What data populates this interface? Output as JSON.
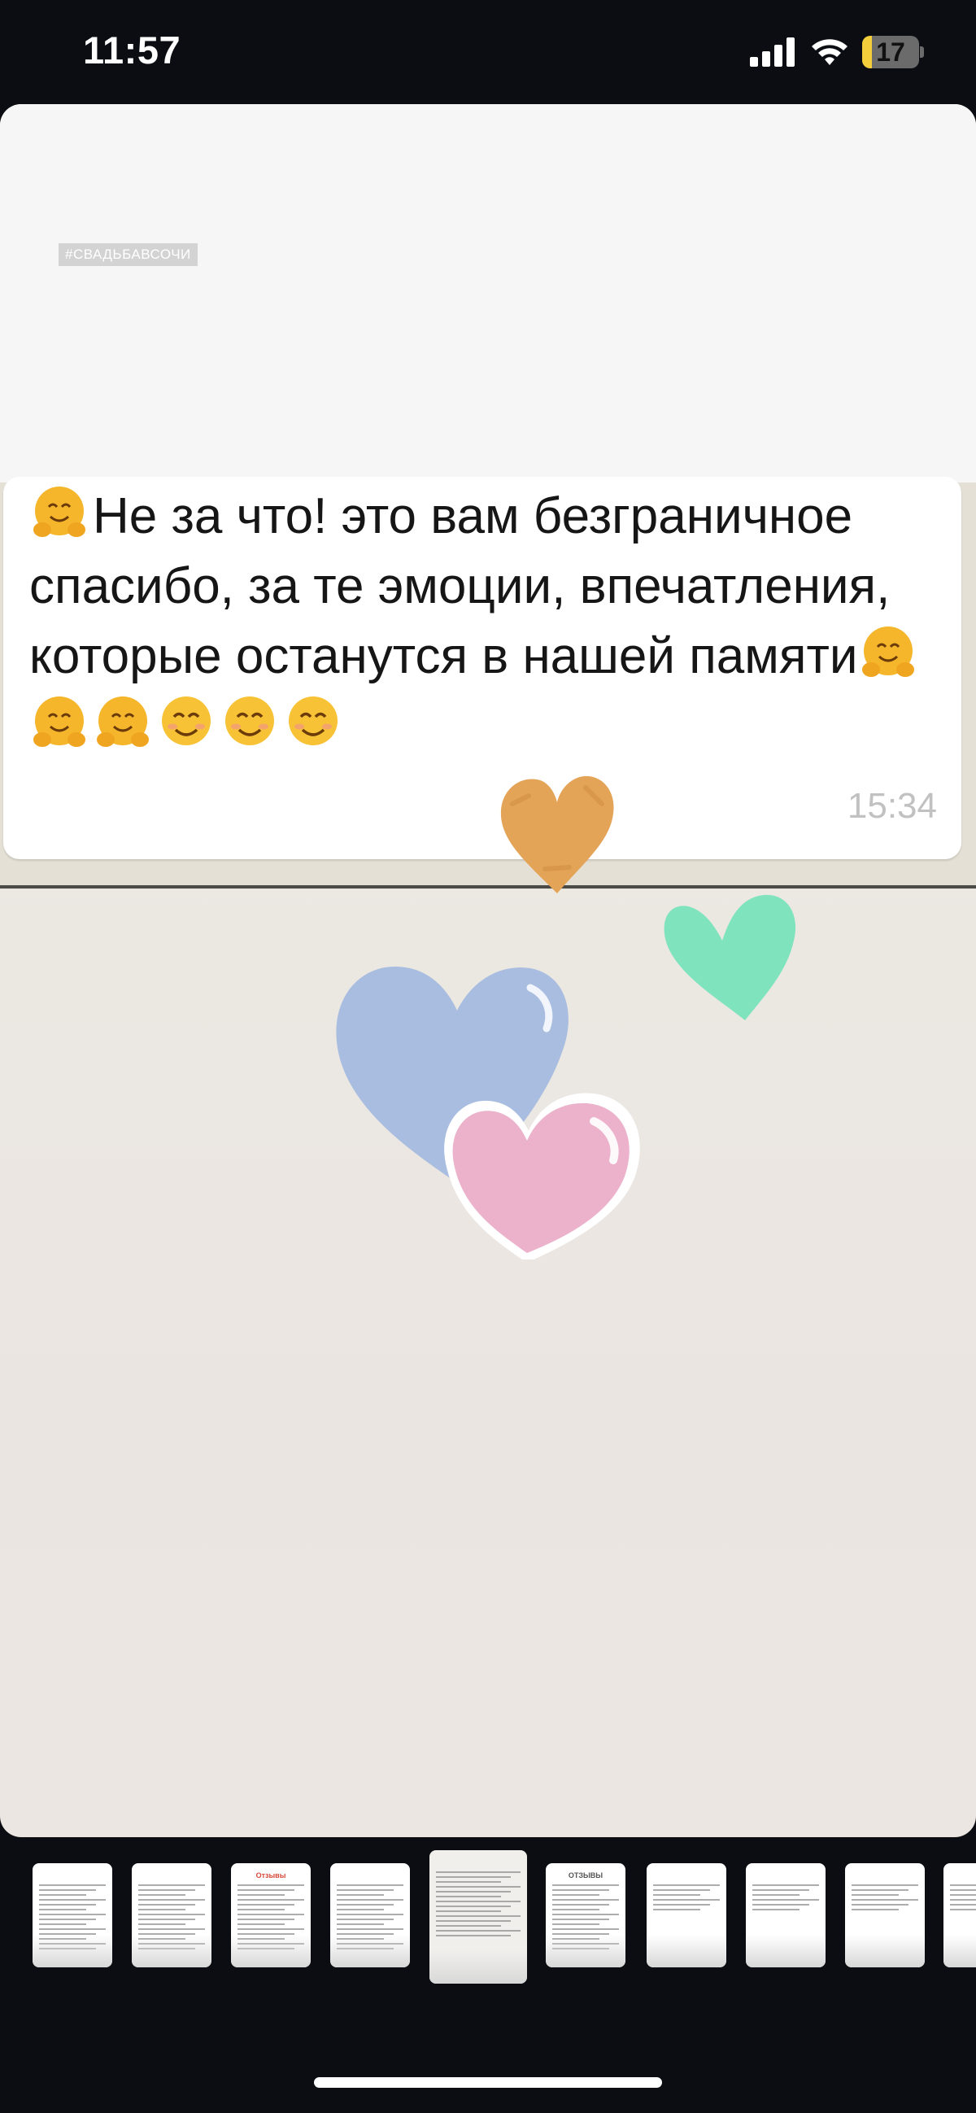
{
  "status_bar": {
    "time": "11:57",
    "battery_level": "17",
    "battery_fraction": 0.17,
    "signal_icon": "cellular-signal-icon",
    "wifi_icon": "wifi-icon",
    "battery_icon": "battery-icon"
  },
  "story": {
    "hashtag": "#СВАДЬБАВСОЧИ",
    "message": {
      "text": "Не за что! это вам безграничное спасибо, за те эмоции, впечатления, которые останутся в нашей памяти",
      "time": "15:34",
      "leading_emoji": "hugging-face-emoji",
      "trailing_emojis": [
        "hugging-face-emoji",
        "hugging-face-emoji",
        "hugging-face-emoji",
        "smiling-face-emoji",
        "smiling-face-emoji",
        "smiling-face-emoji"
      ]
    },
    "stickers": [
      "orange-heart-sticker",
      "green-heart-sticker",
      "blue-heart-sticker",
      "pink-heart-sticker"
    ]
  },
  "thumbnails": {
    "active_index": 4,
    "items": [
      {
        "title": ""
      },
      {
        "title": ""
      },
      {
        "title": "Отзывы"
      },
      {
        "title": ""
      },
      {
        "title": ""
      },
      {
        "title": "ОТЗЫВЫ"
      },
      {
        "title": ""
      },
      {
        "title": ""
      },
      {
        "title": ""
      },
      {
        "title": ""
      }
    ]
  },
  "colors": {
    "hug_emoji": "#f5b62c",
    "smile_emoji": "#f7c236",
    "orange_heart": "#e4a458",
    "green_heart": "#7fe3bd",
    "blue_heart": "#a9bde0",
    "pink_heart": "#ecb2cb"
  }
}
